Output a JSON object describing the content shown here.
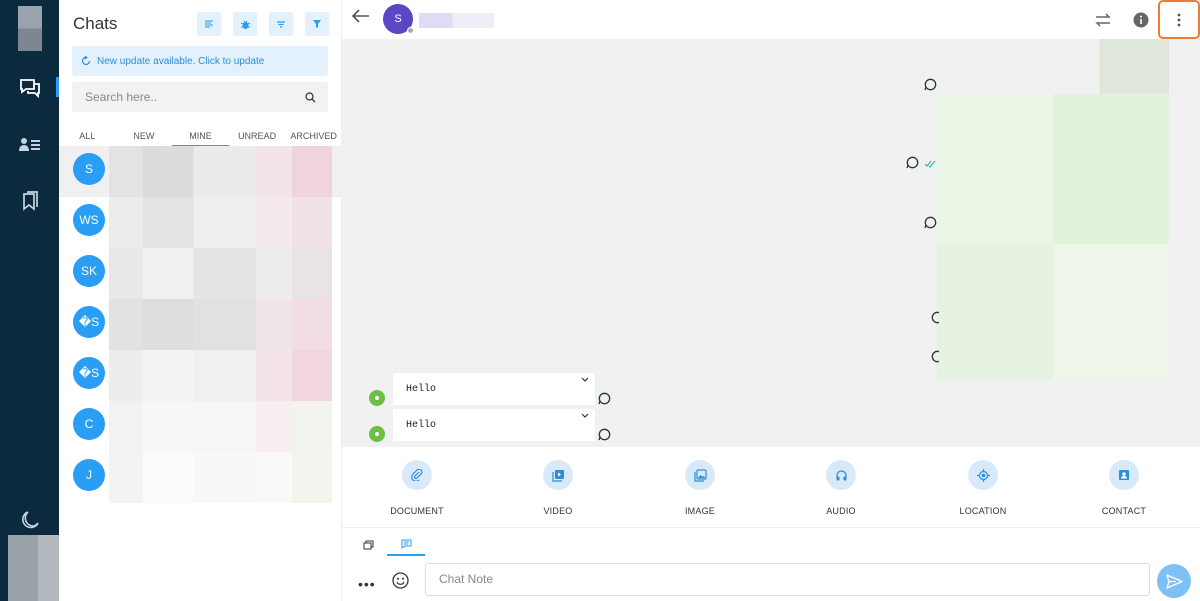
{
  "sidebar": {
    "nav": [
      "chats-icon",
      "contacts-icon",
      "bookmarks-icon"
    ],
    "theme_toggle": "moon-icon"
  },
  "chat_list": {
    "title": "Chats",
    "tools": [
      "list-icon",
      "bug-icon",
      "sort-icon",
      "filter-icon"
    ],
    "update_banner": "New update available. Click to update",
    "search_placeholder": "Search here..",
    "tabs": [
      "ALL",
      "NEW",
      "MINE",
      "UNREAD",
      "ARCHIVED"
    ],
    "active_tab": "MINE",
    "contacts": [
      {
        "initials": "S"
      },
      {
        "initials": "WS"
      },
      {
        "initials": "SK"
      },
      {
        "initials": "�S"
      },
      {
        "initials": "�S"
      },
      {
        "initials": "C"
      },
      {
        "initials": "J"
      }
    ]
  },
  "conversation": {
    "avatar_initial": "S",
    "messages": [
      {
        "text": "Hello"
      },
      {
        "text": "Hello"
      }
    ]
  },
  "attachments": [
    {
      "label": "DOCUMENT",
      "icon": "paperclip-icon"
    },
    {
      "label": "VIDEO",
      "icon": "video-icon"
    },
    {
      "label": "IMAGE",
      "icon": "image-icon"
    },
    {
      "label": "AUDIO",
      "icon": "headphones-icon"
    },
    {
      "label": "LOCATION",
      "icon": "location-icon"
    },
    {
      "label": "CONTACT",
      "icon": "contact-card-icon"
    }
  ],
  "composer": {
    "placeholder": "Chat Note",
    "more_label": "•••"
  },
  "colors": {
    "rail": "#0c2a3e",
    "accent": "#2a9df4",
    "header_avatar": "#5b46c5",
    "online_dot": "#6ebe44",
    "menu_highlight": "#ee7a34"
  }
}
